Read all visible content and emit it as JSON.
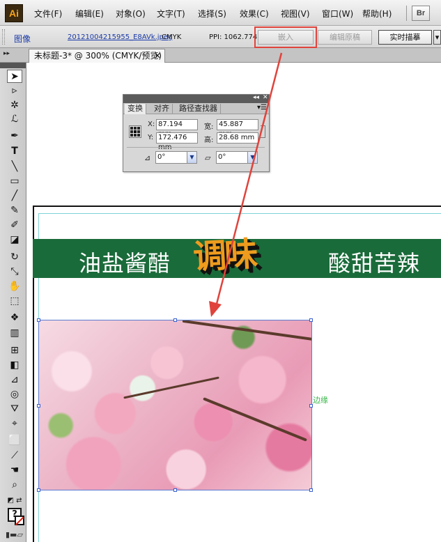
{
  "menubar": {
    "logo": "Ai",
    "items": [
      "文件(F)",
      "编辑(E)",
      "对象(O)",
      "文字(T)",
      "选择(S)",
      "效果(C)",
      "视图(V)",
      "窗口(W)",
      "帮助(H)"
    ],
    "bridge_label": "Br"
  },
  "controlbar": {
    "object_type": "图像",
    "file_name": "20121004215955_E8AVk.jpeg",
    "color_mode": "CMYK",
    "ppi": "PPI: 1062.774",
    "embed_label": "嵌入",
    "edit_original_label": "编辑原稿",
    "live_trace_label": "实时描摹",
    "dropdown_arrow": "▾"
  },
  "tabbar": {
    "collapse": "▸▸",
    "doc_tab": "未标题-3* @ 300% (CMYK/预览)",
    "close": "✕"
  },
  "transform_panel": {
    "tabs": [
      "变换",
      "对齐",
      "路径查找器"
    ],
    "x_label": "X:",
    "x_value": "87.194 mm",
    "y_label": "Y:",
    "y_value": "172.476 mm",
    "w_label": "宽:",
    "w_value": "45.887 mm",
    "h_label": "高:",
    "h_value": "28.68 mm",
    "rotate_value": "0°",
    "shear_value": "0°"
  },
  "canvas": {
    "banner_left": "油盐酱醋",
    "banner_center": "调味",
    "banner_right": "酸甜苦辣",
    "edge_label": "边缘"
  },
  "colors": {
    "banner_green": "#1a6b3a",
    "title_orange": "#ee9b1e",
    "annotation_red": "#e0433c",
    "selection_blue": "#3a5fcc",
    "edge_green": "#39b54a"
  },
  "icons": {
    "tools": [
      "selection-tool-icon",
      "direct-selection-tool-icon",
      "magic-wand-icon",
      "lasso-icon",
      "pen-tool-icon",
      "type-tool-icon",
      "line-tool-icon",
      "rectangle-tool-icon",
      "paintbrush-icon",
      "pencil-icon",
      "blob-brush-icon",
      "eraser-icon",
      "rotate-tool-icon",
      "scale-tool-icon",
      "warp-tool-icon",
      "free-transform-icon",
      "symbol-sprayer-icon",
      "column-graph-icon",
      "mesh-tool-icon",
      "gradient-tool-icon",
      "eyedropper-icon",
      "blend-tool-icon",
      "live-paint-bucket-icon",
      "live-paint-selection-icon",
      "artboard-tool-icon",
      "slice-tool-icon",
      "hand-tool-icon",
      "zoom-tool-icon"
    ]
  }
}
